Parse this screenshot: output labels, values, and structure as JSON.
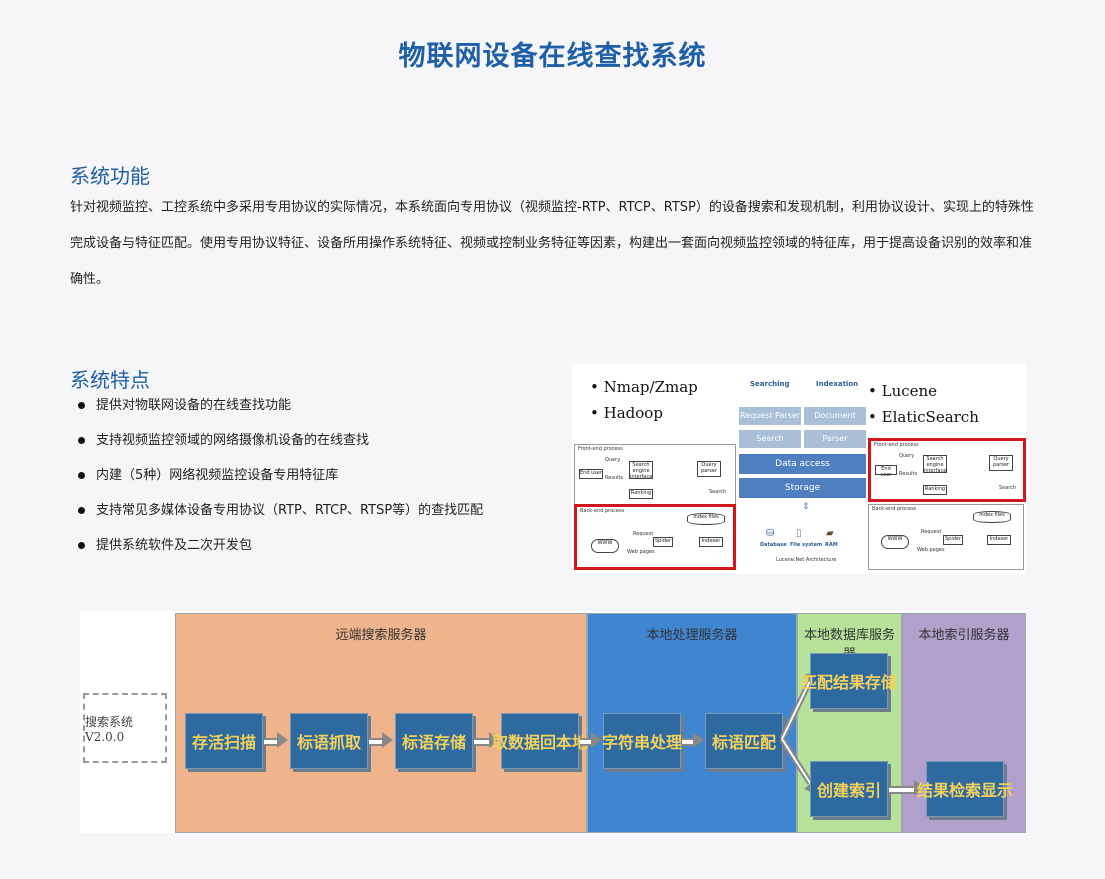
{
  "page_title": "物联网设备在线查找系统",
  "section1": {
    "heading": "系统功能",
    "paragraph": "针对视频监控、工控系统中多采用专用协议的实际情况，本系统面向专用协议（视频监控-RTP、RTCP、RTSP）的设备搜索和发现机制，利用协议设计、实现上的特殊性完成设备与特征匹配。使用专用协议特征、设备所用操作系统特征、视频或控制业务特征等因素，构建出一套面向视频监控领域的特征库，用于提高设备识别的效率和准确性。"
  },
  "section2": {
    "heading": "系统特点",
    "bullets": [
      "提供对物联网设备的在线查找功能",
      "支持视频监控领域的网络摄像机设备的在线查找",
      "内建（5种）网络视频监控设备专用特征库",
      "支持常见多媒体设备专用协议（RTP、RTCP、RTSP等）的查找匹配",
      "提供系统软件及二次开发包"
    ]
  },
  "architecture": {
    "left_tools": [
      "Nmap/Zmap",
      "Hadoop"
    ],
    "right_tools": [
      "Lucene",
      "ElaticSearch"
    ],
    "col_searching": "Searching",
    "col_indexation": "Indexation",
    "request_parser": "Request Parser",
    "document": "Document",
    "search": "Search",
    "parser": "Parser",
    "data_access": "Data access",
    "storage": "Storage",
    "database": "Database",
    "file_system": "File system",
    "ram": "RAM",
    "caption": "Lucene.Net Architecture",
    "front_end": "Front-end process",
    "back_end": "Back-end process",
    "query": "Query",
    "end_user": "End user",
    "results": "Results",
    "search_engine_interface": "Search engine interface",
    "query_parser": "Query parser",
    "ranking": "Ranking",
    "index_files": "Index files",
    "www": "WWW",
    "request": "Request",
    "spider": "Spider",
    "web_pages": "Web pages",
    "indexer": "Indexer"
  },
  "flow": {
    "start": "搜索系统V2.0.0",
    "zones": [
      "远端搜索服务器",
      "本地处理服务器",
      "本地数据库服务器",
      "本地索引服务器"
    ],
    "steps": [
      "存活扫描",
      "标语抓取",
      "标语存储",
      "取数据回本地",
      "字符串处理",
      "标语匹配",
      "匹配结果存储",
      "创建索引",
      "结果检索显示"
    ]
  }
}
